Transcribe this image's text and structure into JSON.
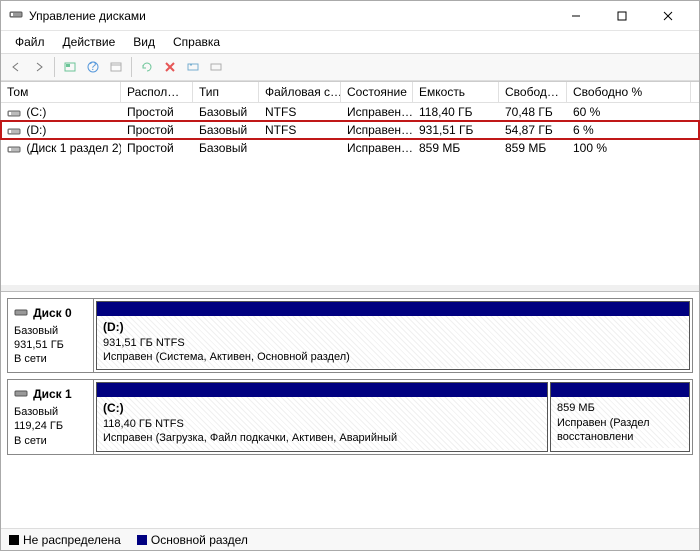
{
  "window": {
    "title": "Управление дисками"
  },
  "menu": {
    "file": "Файл",
    "action": "Действие",
    "view": "Вид",
    "help": "Справка"
  },
  "columns": {
    "vol": "Том",
    "layout": "Распол…",
    "type": "Тип",
    "fs": "Файловая с…",
    "status": "Состояние",
    "capacity": "Емкость",
    "free": "Свобод…",
    "freepct": "Свободно %"
  },
  "volumes": [
    {
      "name": "(C:)",
      "layout": "Простой",
      "type": "Базовый",
      "fs": "NTFS",
      "status": "Исправен…",
      "capacity": "118,40 ГБ",
      "free": "70,48 ГБ",
      "freepct": "60 %",
      "hl": false
    },
    {
      "name": "(D:)",
      "layout": "Простой",
      "type": "Базовый",
      "fs": "NTFS",
      "status": "Исправен…",
      "capacity": "931,51 ГБ",
      "free": "54,87 ГБ",
      "freepct": "6 %",
      "hl": true
    },
    {
      "name": "(Диск 1 раздел 2)",
      "layout": "Простой",
      "type": "Базовый",
      "fs": "",
      "status": "Исправен…",
      "capacity": "859 МБ",
      "free": "859 МБ",
      "freepct": "100 %",
      "hl": false
    }
  ],
  "disks": [
    {
      "label_name": "Диск 0",
      "label_type": "Базовый",
      "label_size": "931,51 ГБ",
      "label_status": "В сети",
      "parts": [
        {
          "title": "(D:)",
          "line1": "931,51 ГБ NTFS",
          "line2": "Исправен (Система, Активен, Основной раздел)",
          "small": false
        }
      ]
    },
    {
      "label_name": "Диск 1",
      "label_type": "Базовый",
      "label_size": "119,24 ГБ",
      "label_status": "В сети",
      "parts": [
        {
          "title": "(C:)",
          "line1": "118,40 ГБ NTFS",
          "line2": "Исправен (Загрузка, Файл подкачки, Активен, Аварийный",
          "small": false
        },
        {
          "title": "",
          "line1": "859 МБ",
          "line2": "Исправен (Раздел восстановлени",
          "small": true
        }
      ]
    }
  ],
  "legend": {
    "unalloc": "Не распределена",
    "primary": "Основной раздел"
  }
}
